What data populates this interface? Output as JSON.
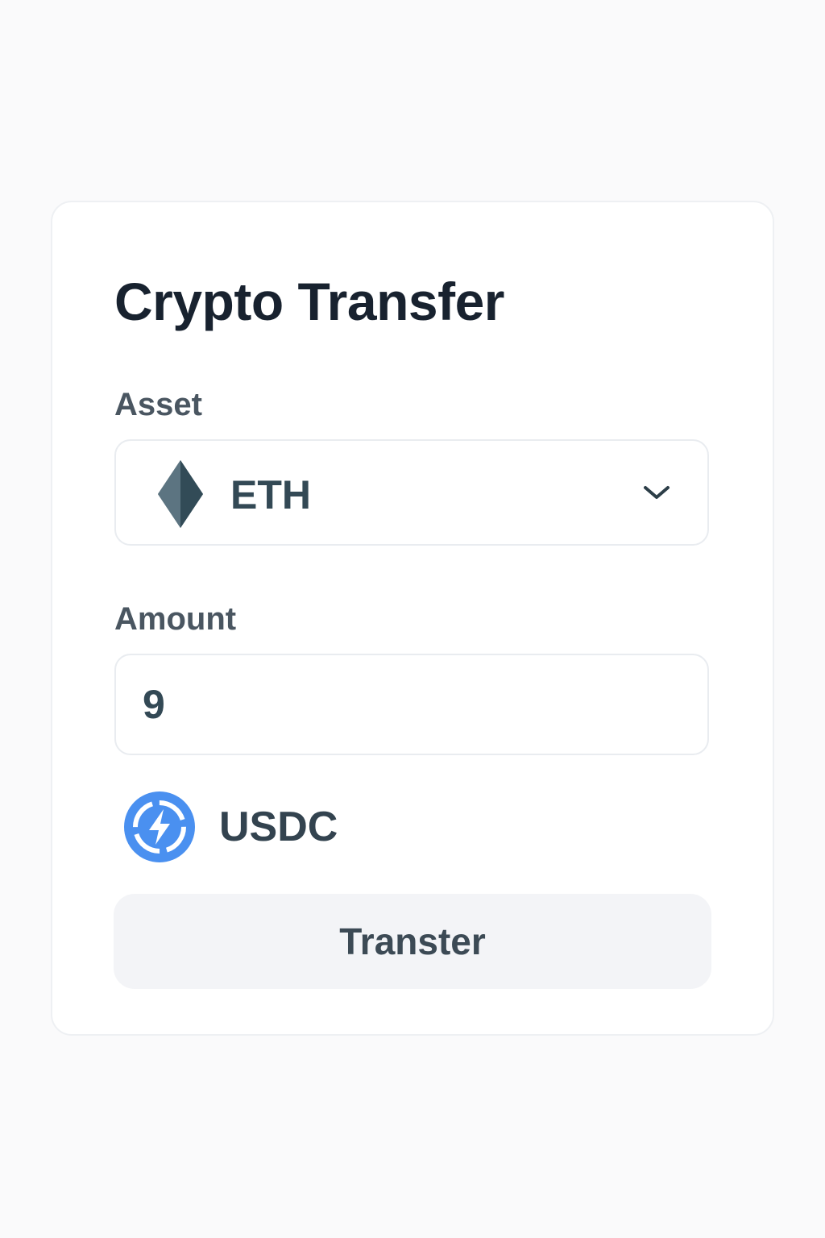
{
  "title": "Crypto Transfer",
  "asset": {
    "label": "Asset",
    "selected": "ETH",
    "icon": "ethereum-icon"
  },
  "amount": {
    "label": "Amount",
    "value": "9"
  },
  "token": {
    "label": "USDC",
    "icon": "usdc-icon"
  },
  "actions": {
    "transfer_label": "Transter"
  },
  "colors": {
    "page_bg": "#fafafb",
    "card_bg": "#ffffff",
    "text_primary": "#18222f",
    "text_label": "#4a5661",
    "accent_blue": "#4a90f0",
    "button_bg": "#f3f4f7"
  }
}
